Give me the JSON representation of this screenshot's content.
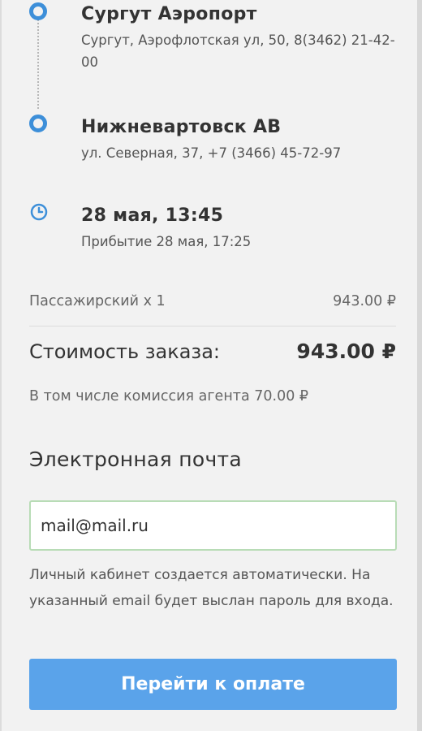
{
  "route": {
    "departure": {
      "name": "Сургут Аэропорт",
      "address": "Сургут, Аэрофлотская ул, 50, 8(3462) 21-42-00"
    },
    "arrival": {
      "name": "Нижневартовск АВ",
      "address": "ул. Северная, 37, +7 (3466) 45-72-97"
    },
    "time": {
      "departure": "28 мая, 13:45",
      "arrival": "Прибытие 28 мая, 17:25"
    },
    "icons": [
      "origin-marker-icon",
      "destination-marker-icon",
      "clock-icon"
    ]
  },
  "order": {
    "passenger_label": "Пассажирский x 1",
    "passenger_price": "943.00 ₽",
    "total_label": "Стоимость заказа:",
    "total_price": "943.00 ₽",
    "commission": "В том числе комиссия агента 70.00 ₽"
  },
  "email": {
    "heading": "Электронная почта",
    "value": "mail@mail.ru",
    "hint": "Личный кабинет создается автоматически. На указанный email будет выслан пароль для входа."
  },
  "actions": {
    "pay_label": "Перейти к оплате"
  },
  "colors": {
    "accent": "#3d8fd9",
    "button": "#5aa3ea",
    "input_border": "#b8dcb6",
    "background": "#f2f2f2"
  }
}
